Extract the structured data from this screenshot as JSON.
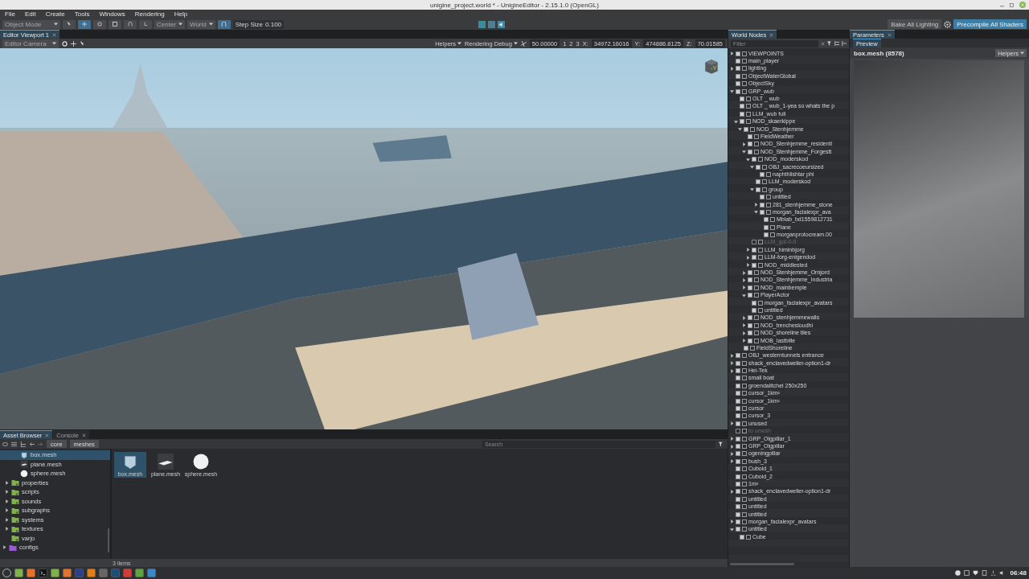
{
  "window": {
    "title": "unigine_project.world * - UnigineEditor - 2.15.1.0 (OpenGL)"
  },
  "menu": [
    "File",
    "Edit",
    "Create",
    "Tools",
    "Windows",
    "Rendering",
    "Help"
  ],
  "toolbar": {
    "mode": "Object Mode",
    "pivot": "Center",
    "space": "World",
    "step_label": "Step Size",
    "step_value": "0.100",
    "bake": "Bake All Lighting",
    "precompile": "Precompile All Shaders"
  },
  "viewport": {
    "tab": "Editor Viewport 1",
    "gizmo_axis": "-Y",
    "camera": "Editor Camera",
    "helpers": "Helpers",
    "rendering": "Rendering Debug",
    "speed": "50.00000",
    "presets": [
      "1",
      "2",
      "3"
    ],
    "coords": [
      {
        "axis": "X:",
        "value": "34972.16016"
      },
      {
        "axis": "Y:",
        "value": "474886.8125"
      },
      {
        "axis": "Z:",
        "value": "70.01585"
      }
    ]
  },
  "world_nodes": {
    "title": "World Nodes",
    "filter_placeholder": "Filter",
    "nodes": [
      {
        "name": "VIEWPOINTS",
        "on": true,
        "expanded": false
      },
      {
        "name": "main_player",
        "on": true
      },
      {
        "name": "lighting",
        "on": true,
        "expanded": false
      },
      {
        "name": "ObjectWaterGlobal",
        "on": true
      },
      {
        "name": "ObjectSky",
        "on": true
      },
      {
        "name": "GRP_wub",
        "on": true,
        "expanded": true,
        "children": [
          {
            "name": "OLT _ wub",
            "on": true
          },
          {
            "name": "OLT _ wub_1-yea so whats the p",
            "on": true
          },
          {
            "name": "LLM_wub full",
            "on": true
          },
          {
            "name": "NOD_skaerkippe",
            "on": true,
            "expanded": true,
            "children": [
              {
                "name": "NOD_Stenhjemme",
                "on": true,
                "expanded": true,
                "children": [
                  {
                    "name": "FieldWeather",
                    "on": true
                  },
                  {
                    "name": "NOD_Stenhjemme_residenti",
                    "on": true,
                    "expanded": false
                  },
                  {
                    "name": "NOD_Stenhjemme_Forgestt",
                    "on": true,
                    "expanded": true,
                    "children": [
                      {
                        "name": "NOD_moderskod",
                        "on": true,
                        "expanded": true,
                        "children": [
                          {
                            "name": "OBJ_sacrecoeursized",
                            "on": true,
                            "expanded": true,
                            "children": [
                              {
                                "name": "naphthlishtar phi",
                                "on": true
                              }
                            ]
                          },
                          {
                            "name": "LLM_moderskod",
                            "on": true
                          },
                          {
                            "name": "group",
                            "on": true,
                            "expanded": true,
                            "children": [
                              {
                                "name": "untitled",
                                "on": true
                              },
                              {
                                "name": "281_stenhjemme_stone",
                                "on": true,
                                "expanded": false
                              },
                              {
                                "name": "morgan_facialexpr_ava",
                                "on": true,
                                "expanded": true,
                                "children": [
                                  {
                                    "name": "Mblab_bd1559812731",
                                    "on": true
                                  },
                                  {
                                    "name": "Plane",
                                    "on": true
                                  },
                                  {
                                    "name": "morganprotocream.00",
                                    "on": true
                                  }
                                ]
                              }
                            ]
                          }
                        ]
                      },
                      {
                        "name": "LLM_gol-0-0",
                        "on": false
                      },
                      {
                        "name": "LLM_himinbjorg",
                        "on": true,
                        "expanded": false
                      },
                      {
                        "name": "LLM-forg-enigendod",
                        "on": true,
                        "expanded": false
                      },
                      {
                        "name": "NOD_middlested",
                        "on": true,
                        "expanded": false
                      }
                    ]
                  },
                  {
                    "name": "NOD_Stenhjemme_Ornjord",
                    "on": true,
                    "expanded": false
                  },
                  {
                    "name": "NOD_Stenhjemme_Industria",
                    "on": true,
                    "expanded": false
                  },
                  {
                    "name": "NOD_mainbemple",
                    "on": true,
                    "expanded": false
                  },
                  {
                    "name": "PlayerActor",
                    "on": true,
                    "expanded": true,
                    "children": [
                      {
                        "name": "morgan_facialexpr_avatars",
                        "on": true
                      },
                      {
                        "name": "untitled",
                        "on": true
                      }
                    ]
                  },
                  {
                    "name": "NOD_stenhjemmewalls",
                    "on": true,
                    "expanded": false
                  },
                  {
                    "name": "NOD_trenchesloudhi",
                    "on": true,
                    "expanded": false
                  },
                  {
                    "name": "NOD_shoreline tiles",
                    "on": true,
                    "expanded": false
                  },
                  {
                    "name": "MOB_lastbille",
                    "on": true,
                    "expanded": false
                  }
                ]
              },
              {
                "name": "FieldShoreline",
                "on": true
              }
            ]
          }
        ]
      },
      {
        "name": "OBJ_westerntunnels entrance",
        "on": true,
        "expanded": false
      },
      {
        "name": "shack_enclavedweller-option1-dr",
        "on": true,
        "expanded": false
      },
      {
        "name": "Hei-Tek",
        "on": true,
        "expanded": false
      },
      {
        "name": "small boat",
        "on": true
      },
      {
        "name": "groendalitchel 250x250",
        "on": true
      },
      {
        "name": "cursor_1km²",
        "on": true
      },
      {
        "name": "cursor_1km²",
        "on": true
      },
      {
        "name": "cursor",
        "on": true
      },
      {
        "name": "cursor_3",
        "on": true
      },
      {
        "name": "unused",
        "on": true,
        "expanded": false
      },
      {
        "name": "to unwsh",
        "on": false
      },
      {
        "name": "GRP_Olgpillar_1",
        "on": true,
        "expanded": false
      },
      {
        "name": "GRP_Olgpillar",
        "on": true,
        "expanded": false
      },
      {
        "name": "ogeningpillar",
        "on": true,
        "expanded": false
      },
      {
        "name": "bush_3",
        "on": true,
        "expanded": false
      },
      {
        "name": "Cuboid_1",
        "on": true
      },
      {
        "name": "Cuboid_2",
        "on": true
      },
      {
        "name": "1m³",
        "on": true
      },
      {
        "name": "shack_enclavedweller-option1-dr",
        "on": true,
        "expanded": false
      },
      {
        "name": "untitled",
        "on": true
      },
      {
        "name": "untitled",
        "on": true
      },
      {
        "name": "untitled",
        "on": true
      },
      {
        "name": "morgan_facialexpr_avatars",
        "on": true,
        "expanded": false
      },
      {
        "name": "untitled",
        "on": true,
        "expanded": true,
        "children": [
          {
            "name": "Cube",
            "on": true
          }
        ]
      }
    ]
  },
  "parameters": {
    "title": "Parameters",
    "tab": "Preview",
    "asset": "box.mesh (8578)",
    "helpers": "Helpers"
  },
  "asset_browser": {
    "tabs": [
      {
        "label": "Asset Browser",
        "selected": true
      },
      {
        "label": "Console",
        "selected": false
      }
    ],
    "path": [
      "core",
      "meshes"
    ],
    "tree": [
      {
        "name": "box.mesh",
        "kind": "box",
        "selected": true
      },
      {
        "name": "plane.mesh",
        "kind": "plane",
        "selected": false
      },
      {
        "name": "sphere.mesh",
        "kind": "sphere",
        "selected": false
      },
      {
        "name": "properties",
        "kind": "folder",
        "selected": false,
        "expanded": false
      },
      {
        "name": "scripts",
        "kind": "folder",
        "selected": false,
        "expanded": false
      },
      {
        "name": "sounds",
        "kind": "folder",
        "selected": false,
        "expanded": false
      },
      {
        "name": "subgraphs",
        "kind": "folder",
        "selected": false,
        "expanded": false
      },
      {
        "name": "systems",
        "kind": "folder",
        "selected": false,
        "expanded": false
      },
      {
        "name": "textures",
        "kind": "folder",
        "selected": false,
        "expanded": false
      },
      {
        "name": "varjo",
        "kind": "folder",
        "selected": false
      },
      {
        "name": "configs",
        "kind": "config",
        "selected": false,
        "expanded": false
      }
    ],
    "search_placeholder": "Search",
    "files": [
      {
        "name": "box.mesh",
        "kind": "box",
        "selected": true
      },
      {
        "name": "plane.mesh",
        "kind": "plane",
        "selected": false
      },
      {
        "name": "sphere.mesh",
        "kind": "sphere",
        "selected": false
      }
    ],
    "status": "3 items"
  },
  "taskbar": {
    "clock": "06:48"
  }
}
